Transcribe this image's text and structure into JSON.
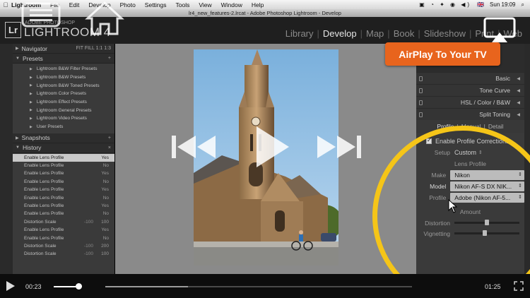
{
  "menubar": {
    "apple": "",
    "items": [
      "Lightroom",
      "File",
      "Edit",
      "Develop",
      "Photo",
      "Settings",
      "Tools",
      "View",
      "Window",
      "Help"
    ],
    "right_flag": "🇬🇧",
    "clock": "Sun 19:09"
  },
  "window": {
    "title": "lr4_new_features-2.lrcat - Adobe Photoshop Lightroom - Develop"
  },
  "identity": {
    "badge": "Lr",
    "sub": "ADOBE PHOTOSHOP",
    "name": "LIGHTROOM 4"
  },
  "modules": [
    "Library",
    "Develop",
    "Map",
    "Book",
    "Slideshow",
    "Print",
    "Web"
  ],
  "left_panel": {
    "navigator": {
      "label": "Navigator",
      "zoom": "FIT  FILL  1:1  1:3"
    },
    "presets": {
      "label": "Presets",
      "items": [
        "Lightroom B&W Filter Presets",
        "Lightroom B&W Presets",
        "Lightroom B&W Toned Presets",
        "Lightroom Color Presets",
        "Lightroom Effect Presets",
        "Lightroom General Presets",
        "Lightroom Video Presets",
        "User Presets"
      ]
    },
    "snapshots": {
      "label": "Snapshots",
      "action": "+"
    },
    "history": {
      "label": "History",
      "action": "×",
      "rows": [
        {
          "name": "Enable Lens Profile",
          "b": "",
          "a": "Yes"
        },
        {
          "name": "Enable Lens Profile",
          "b": "",
          "a": "No"
        },
        {
          "name": "Enable Lens Profile",
          "b": "",
          "a": "Yes"
        },
        {
          "name": "Enable Lens Profile",
          "b": "",
          "a": "No"
        },
        {
          "name": "Enable Lens Profile",
          "b": "",
          "a": "Yes"
        },
        {
          "name": "Enable Lens Profile",
          "b": "",
          "a": "No"
        },
        {
          "name": "Enable Lens Profile",
          "b": "",
          "a": "Yes"
        },
        {
          "name": "Enable Lens Profile",
          "b": "",
          "a": "No"
        },
        {
          "name": "Distortion Scale",
          "b": "-100",
          "a": "100"
        },
        {
          "name": "Enable Lens Profile",
          "b": "",
          "a": "Yes"
        },
        {
          "name": "Enable Lens Profile",
          "b": "",
          "a": "No"
        },
        {
          "name": "Distortion Scale",
          "b": "-100",
          "a": "200"
        },
        {
          "name": "Distortion Scale",
          "b": "-100",
          "a": "100"
        }
      ]
    }
  },
  "right_panel": {
    "sections": [
      "Basic",
      "Tone Curve",
      "HSL / Color / B&W",
      "Split Toning"
    ],
    "lens_tabs": [
      "Profile",
      "Manual",
      "Detail"
    ],
    "enable_label": "Enable Profile Corrections",
    "setup_label": "Setup",
    "setup_value": "Custom",
    "lens_profile_title": "Lens Profile",
    "make_label": "Make",
    "make_value": "Nikon",
    "model_label": "Model",
    "model_value": "Nikon AF-S DX NIK...",
    "profile_label": "Profile",
    "profile_value": "Adobe (Nikon AF-5...",
    "amount_title": "Amount",
    "distortion_label": "Distortion",
    "vignetting_label": "Vignetting",
    "distortion_level": 0.5,
    "vignetting_level": 0.47
  },
  "overlay": {
    "airplay_label": "AirPlay To Your TV",
    "accent": "#e8641d",
    "ring_color": "#f5c518"
  },
  "player": {
    "current": "00:23",
    "duration": "01:25",
    "volume_level": 0.88,
    "progress_level": 0.27
  }
}
